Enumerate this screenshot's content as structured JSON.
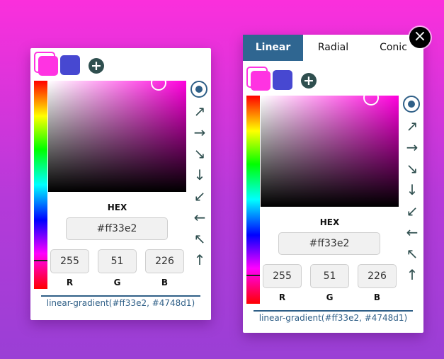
{
  "colors": {
    "primary": "#ff33e2",
    "secondary": "#4748d1",
    "accent": "#2f6691"
  },
  "icons": {
    "add": "plus-icon",
    "close": "close-icon",
    "rotate": "rotate-icon",
    "directions": [
      "arrow-up-right-icon",
      "arrow-right-icon",
      "arrow-down-right-icon",
      "arrow-down-icon",
      "arrow-down-left-icon",
      "arrow-left-icon",
      "arrow-up-left-icon",
      "arrow-up-icon"
    ]
  },
  "glyphs": {
    "add": "+",
    "close": "×",
    "directions": [
      "↗",
      "→",
      "↘",
      "↓",
      "↙",
      "←",
      "↖",
      "↑"
    ]
  },
  "tabs": [
    {
      "label": "Linear",
      "active": true
    },
    {
      "label": "Radial",
      "active": false
    },
    {
      "label": "Conic",
      "active": false
    }
  ],
  "picker": {
    "hex_label": "HEX",
    "hex_value": "#ff33e2",
    "r_label": "R",
    "g_label": "G",
    "b_label": "B",
    "r": "255",
    "g": "51",
    "b": "226",
    "hue_fraction": 0.86,
    "saturation": 0.8,
    "value": 1.0
  },
  "css_output": "linear-gradient(#ff33e2, #4748d1)"
}
